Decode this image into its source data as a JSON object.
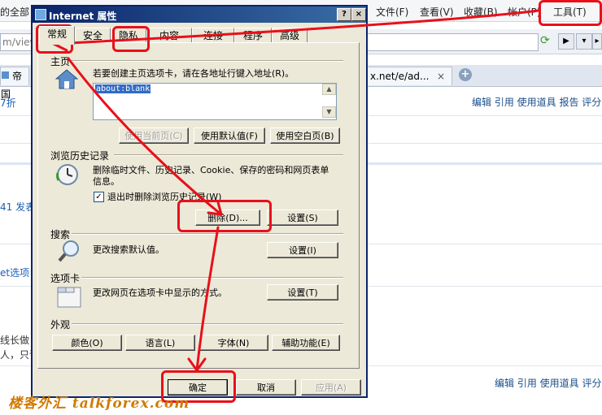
{
  "browser": {
    "menu": [
      "文件(F)",
      "查看(V)",
      "收藏(B)",
      "帐户(P)",
      "工具(T)"
    ],
    "left_snippet": "的全部",
    "address": "m/view",
    "tabs": [
      "帝国",
      "x.net/e/ad..."
    ],
    "new_tab": "+",
    "tab_close": "×",
    "fragments": [
      "7折",
      "41 发表",
      "et选项!",
      "线长做",
      "人，只读"
    ],
    "actions": "编辑 引用 使用道具 报告 评分",
    "actions_bottom": "编辑 引用 使用道具 评分"
  },
  "dialog": {
    "title": "Internet 属性",
    "help": "?",
    "close": "×",
    "tabs": [
      "常规",
      "安全",
      "隐私",
      "内容",
      "连接",
      "程序",
      "高级"
    ],
    "homepage": {
      "heading": "主页",
      "desc": "若要创建主页选项卡，请在各地址行键入地址(R)。",
      "value": "about:blank",
      "btn_current": "使用当前页(C)",
      "btn_default": "使用默认值(F)",
      "btn_blank": "使用空白页(B)"
    },
    "history": {
      "heading": "浏览历史记录",
      "desc": "删除临时文件、历史记录、Cookie、保存的密码和网页表单信息。",
      "checkbox": "退出时删除浏览历史记录(W)",
      "checked": true,
      "btn_delete": "删除(D)...",
      "btn_settings": "设置(S)"
    },
    "search": {
      "heading": "搜索",
      "desc": "更改搜索默认值。",
      "btn_settings": "设置(I)"
    },
    "tabsec": {
      "heading": "选项卡",
      "desc": "更改网页在选项卡中显示的方式。",
      "btn_settings": "设置(T)"
    },
    "appearance": {
      "heading": "外观",
      "btn_colors": "颜色(O)",
      "btn_lang": "语言(L)",
      "btn_fonts": "字体(N)",
      "btn_access": "辅助功能(E)"
    },
    "footer": {
      "ok": "确定",
      "cancel": "取消",
      "apply": "应用(A)"
    }
  },
  "watermark": "楼客外汇 talkforex.com",
  "colors": {
    "annotation": "#e8101a",
    "dialog_face": "#ece9d8",
    "titlebar": "#0a246a"
  }
}
